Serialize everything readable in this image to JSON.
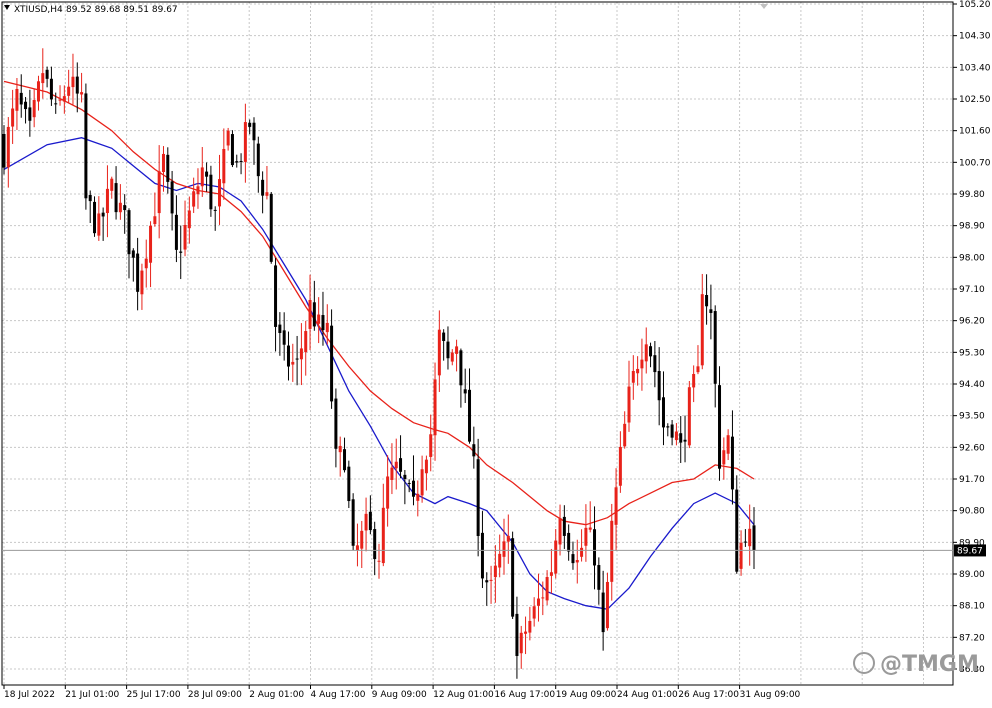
{
  "header": {
    "symbol": "XTIUSD,H4",
    "ohlc": "89.52 89.68 89.51 89.67"
  },
  "watermark": "@TMGM",
  "current_price_label": "89.67",
  "colors": {
    "background": "#ffffff",
    "grid": "#c8c8c8",
    "bull_candle": "#e8221a",
    "bear_candle": "#000000",
    "ma_fast": "#1a1acc",
    "ma_slow": "#e8221a"
  },
  "chart_data": {
    "type": "candlestick",
    "symbol": "XTIUSD",
    "timeframe": "H4",
    "ylim": [
      85.9,
      105.2
    ],
    "y_ticks": [
      "105.20",
      "104.30",
      "103.40",
      "102.50",
      "101.60",
      "100.70",
      "99.80",
      "98.90",
      "98.00",
      "97.10",
      "96.20",
      "95.30",
      "94.40",
      "93.50",
      "92.60",
      "91.70",
      "90.80",
      "89.90",
      "89.00",
      "88.10",
      "87.20",
      "86.30"
    ],
    "x_ticks": [
      "18 Jul 2022",
      "21 Jul 01:00",
      "25 Jul 17:00",
      "28 Jul 09:00",
      "2 Aug 01:00",
      "4 Aug 17:00",
      "9 Aug 09:00",
      "12 Aug 01:00",
      "16 Aug 17:00",
      "19 Aug 09:00",
      "24 Aug 01:00",
      "26 Aug 17:00",
      "31 Aug 09:00"
    ],
    "last_price": 89.67,
    "close_path": [
      [
        0,
        101.0
      ],
      [
        3,
        102.5
      ],
      [
        6,
        101.5
      ],
      [
        9,
        103.3
      ],
      [
        12,
        102.0
      ],
      [
        15,
        103.0
      ],
      [
        18,
        102.3
      ],
      [
        19,
        99.6
      ],
      [
        22,
        98.8
      ],
      [
        25,
        100.0
      ],
      [
        28,
        99.0
      ],
      [
        31,
        97.3
      ],
      [
        34,
        98.9
      ],
      [
        37,
        100.7
      ],
      [
        40,
        98.0
      ],
      [
        43,
        99.2
      ],
      [
        46,
        100.5
      ],
      [
        49,
        99.2
      ],
      [
        52,
        101.4
      ],
      [
        54,
        100.6
      ],
      [
        57,
        101.8
      ],
      [
        59,
        100.3
      ],
      [
        61,
        99.8
      ],
      [
        63,
        96.1
      ],
      [
        65,
        95.1
      ],
      [
        68,
        94.9
      ],
      [
        71,
        96.6
      ],
      [
        73,
        96.0
      ],
      [
        75,
        95.8
      ],
      [
        77,
        92.2
      ],
      [
        79,
        92.4
      ],
      [
        81,
        89.4
      ],
      [
        84,
        90.3
      ],
      [
        87,
        89.6
      ],
      [
        89,
        91.6
      ],
      [
        91,
        91.9
      ],
      [
        93,
        91.5
      ],
      [
        95,
        90.8
      ],
      [
        97,
        92.3
      ],
      [
        99,
        93.0
      ],
      [
        101,
        95.7
      ],
      [
        103,
        95.0
      ],
      [
        105,
        95.6
      ],
      [
        107,
        93.8
      ],
      [
        109,
        91.9
      ],
      [
        111,
        89.1
      ],
      [
        113,
        88.5
      ],
      [
        115,
        89.4
      ],
      [
        117,
        89.8
      ],
      [
        119,
        86.6
      ],
      [
        121,
        87.4
      ],
      [
        123,
        87.9
      ],
      [
        125,
        88.5
      ],
      [
        127,
        89.2
      ],
      [
        129,
        90.9
      ],
      [
        131,
        90.0
      ],
      [
        133,
        89.3
      ],
      [
        135,
        90.2
      ],
      [
        137,
        89.6
      ],
      [
        139,
        87.1
      ],
      [
        141,
        90.3
      ],
      [
        143,
        92.3
      ],
      [
        145,
        94.0
      ],
      [
        147,
        95.1
      ],
      [
        149,
        95.9
      ],
      [
        151,
        94.8
      ],
      [
        153,
        93.2
      ],
      [
        155,
        93.3
      ],
      [
        157,
        92.5
      ],
      [
        159,
        93.9
      ],
      [
        161,
        94.6
      ],
      [
        162,
        97.3
      ],
      [
        164,
        96.3
      ],
      [
        166,
        92.3
      ],
      [
        168,
        92.8
      ],
      [
        170,
        89.4
      ],
      [
        172,
        90.3
      ],
      [
        174,
        89.67
      ]
    ],
    "series": [
      {
        "name": "",
        "type": "ma",
        "points": [
          [
            0,
            100.5
          ],
          [
            10,
            101.2
          ],
          [
            18,
            101.4
          ],
          [
            25,
            101.1
          ],
          [
            30,
            100.6
          ],
          [
            35,
            100.1
          ],
          [
            40,
            99.9
          ],
          [
            45,
            100.1
          ],
          [
            50,
            100.0
          ],
          [
            55,
            99.6
          ],
          [
            60,
            98.8
          ],
          [
            65,
            97.8
          ],
          [
            70,
            96.8
          ],
          [
            75,
            95.5
          ],
          [
            80,
            94.2
          ],
          [
            85,
            93.2
          ],
          [
            90,
            92.1
          ],
          [
            95,
            91.3
          ],
          [
            100,
            91.0
          ],
          [
            103,
            91.2
          ],
          [
            108,
            91.0
          ],
          [
            112,
            90.8
          ],
          [
            118,
            89.9
          ],
          [
            122,
            89.0
          ],
          [
            126,
            88.5
          ],
          [
            130,
            88.3
          ],
          [
            135,
            88.1
          ],
          [
            140,
            88.0
          ],
          [
            145,
            88.6
          ],
          [
            150,
            89.5
          ],
          [
            155,
            90.3
          ],
          [
            160,
            91.0
          ],
          [
            165,
            91.3
          ],
          [
            170,
            91.0
          ],
          [
            174,
            90.4
          ]
        ]
      },
      {
        "name": "",
        "type": "ma",
        "points": [
          [
            0,
            103.0
          ],
          [
            10,
            102.7
          ],
          [
            18,
            102.2
          ],
          [
            25,
            101.6
          ],
          [
            30,
            101.0
          ],
          [
            35,
            100.5
          ],
          [
            40,
            100.1
          ],
          [
            45,
            99.9
          ],
          [
            50,
            99.8
          ],
          [
            55,
            99.3
          ],
          [
            60,
            98.6
          ],
          [
            65,
            97.6
          ],
          [
            70,
            96.6
          ],
          [
            75,
            95.7
          ],
          [
            80,
            94.9
          ],
          [
            85,
            94.2
          ],
          [
            90,
            93.7
          ],
          [
            95,
            93.3
          ],
          [
            100,
            93.1
          ],
          [
            103,
            93.0
          ],
          [
            108,
            92.6
          ],
          [
            112,
            92.1
          ],
          [
            118,
            91.6
          ],
          [
            122,
            91.2
          ],
          [
            126,
            90.8
          ],
          [
            130,
            90.5
          ],
          [
            135,
            90.4
          ],
          [
            140,
            90.6
          ],
          [
            145,
            91.0
          ],
          [
            150,
            91.3
          ],
          [
            155,
            91.6
          ],
          [
            160,
            91.7
          ],
          [
            165,
            92.1
          ],
          [
            170,
            92.0
          ],
          [
            174,
            91.7
          ]
        ]
      }
    ]
  }
}
